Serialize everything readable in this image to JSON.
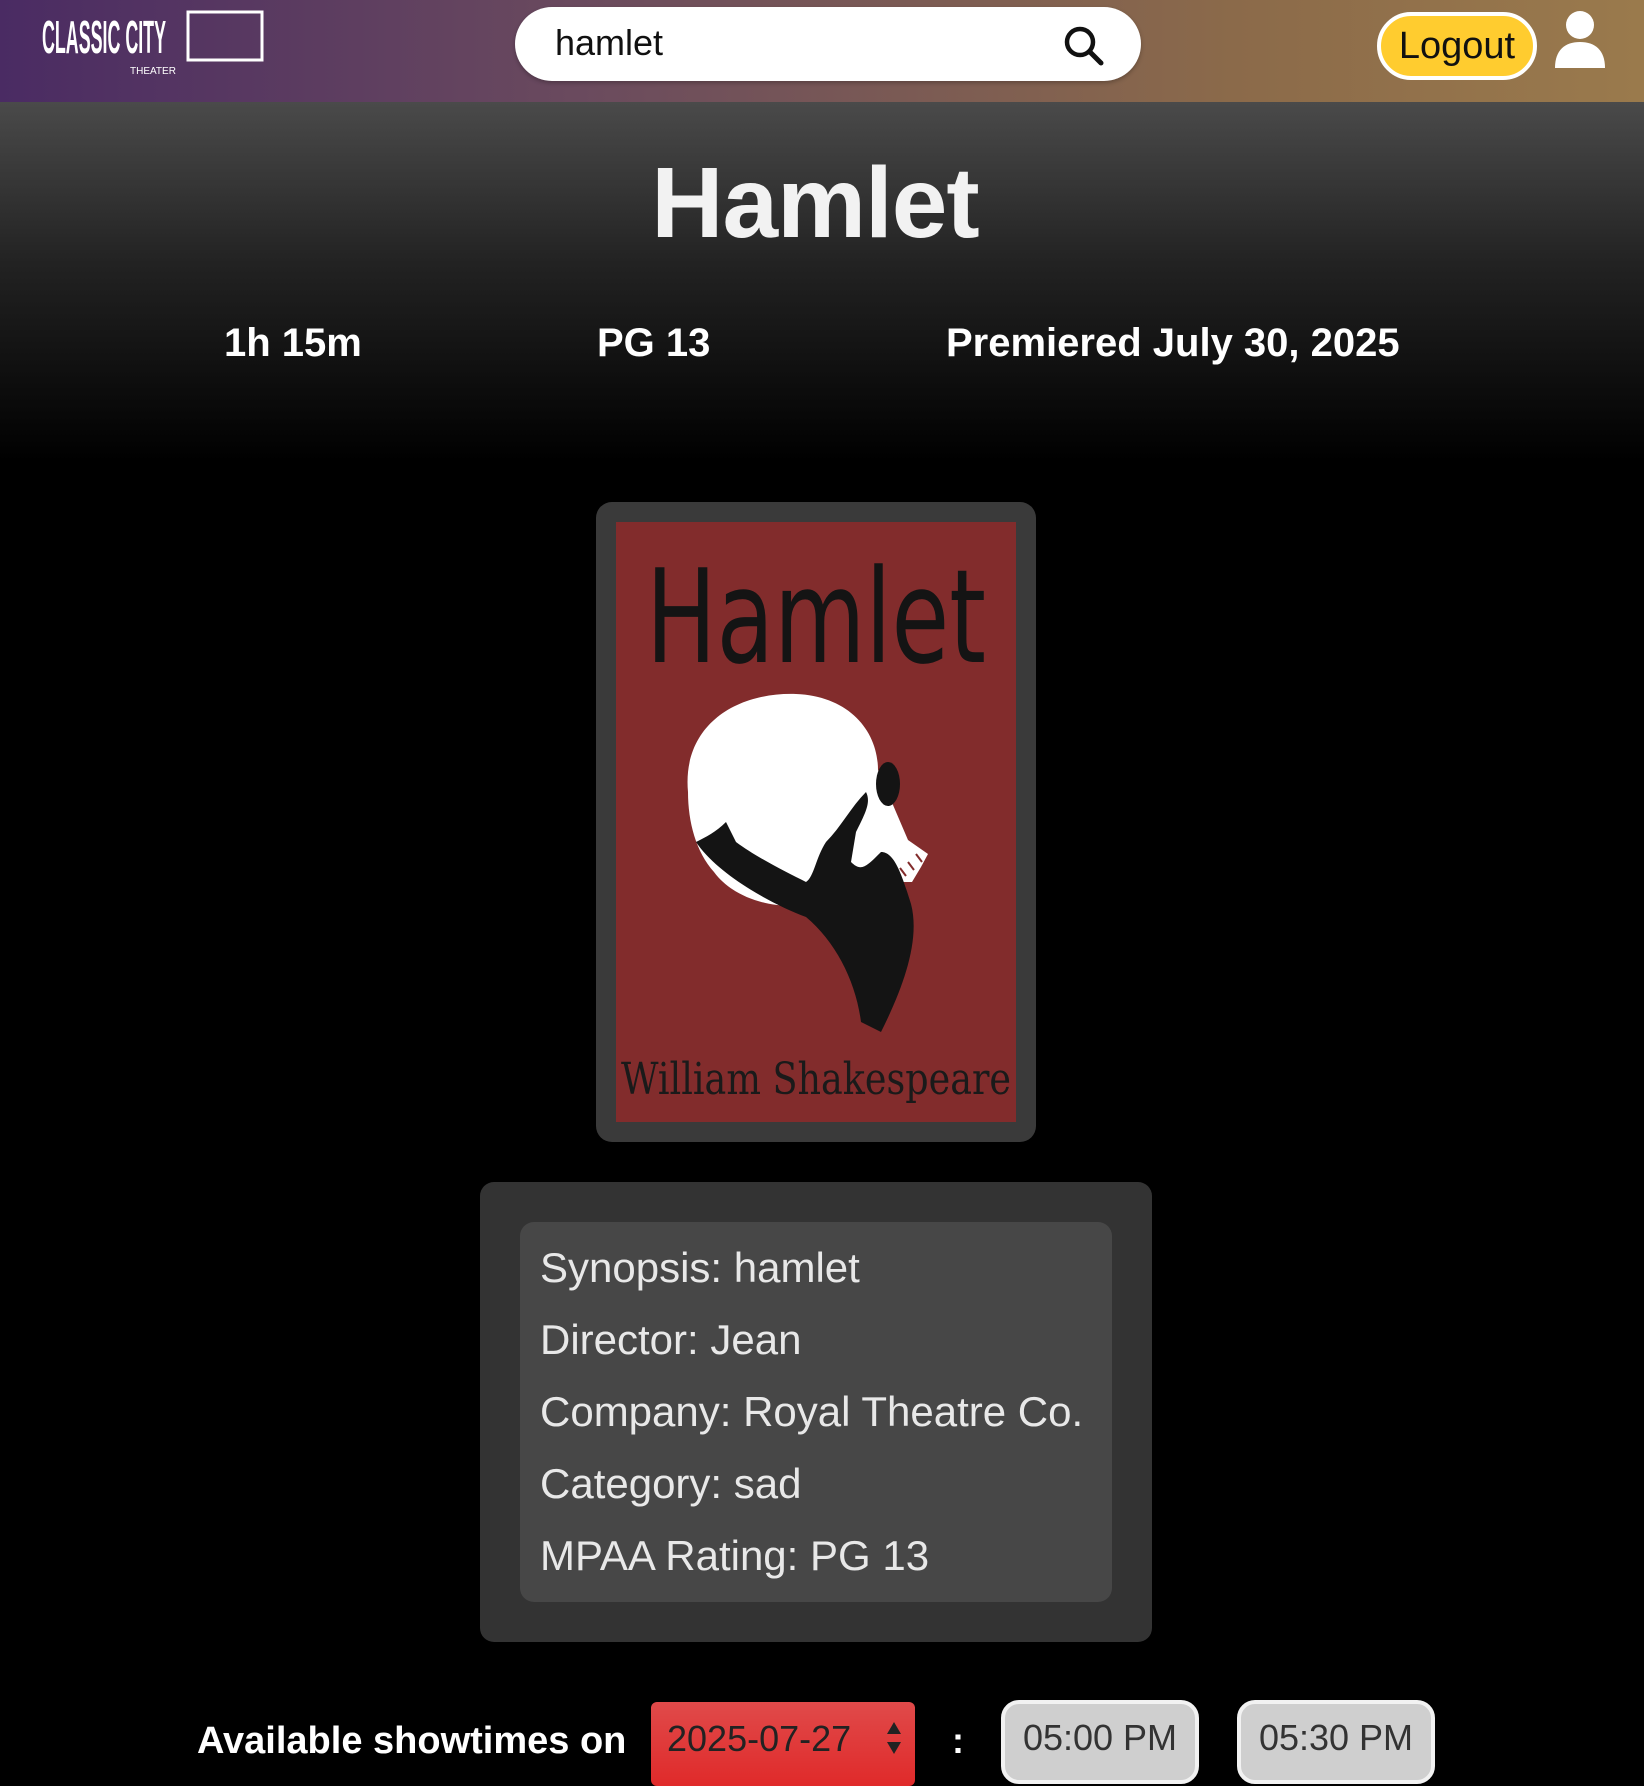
{
  "header": {
    "logo_text": "CLASSIC CITY",
    "logo_subtext": "THEATER",
    "search_value": "hamlet",
    "logout_label": "Logout"
  },
  "show": {
    "title": "Hamlet",
    "runtime": "1h 15m",
    "rating": "PG 13",
    "premiere": "Premiered July 30, 2025"
  },
  "poster": {
    "title_text": "Hamlet",
    "author_text": "William Shakespeare"
  },
  "details": [
    "Synopsis: hamlet",
    "Director: Jean",
    "Company: Royal Theatre Co.",
    "Category: sad",
    "MPAA Rating: PG 13"
  ],
  "showtimes": {
    "label": "Available showtimes on",
    "date": "2025-07-27",
    "separator": ":",
    "times": [
      "05:00 PM",
      "05:30 PM"
    ]
  }
}
